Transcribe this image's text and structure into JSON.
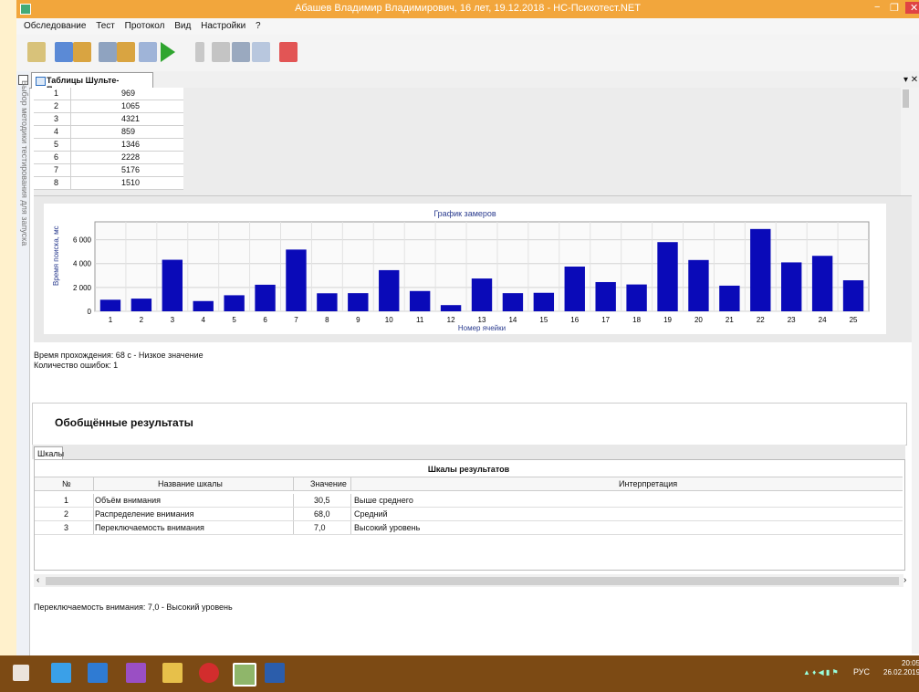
{
  "window": {
    "title": "Абашев Владимир Владимирович, 16 лет, 19.12.2018 - НС-Психотест.NET",
    "controls": [
      "−",
      "❐",
      "✕"
    ]
  },
  "menu": [
    "Обследование",
    "Тест",
    "Протокол",
    "Вид",
    "Настройки",
    "?"
  ],
  "side_panel_label": "Выбор методики тестирования для запуска",
  "doc_tab": "Таблицы Шульте-Платоно...",
  "measurements_table": [
    {
      "n": "1",
      "v": "969"
    },
    {
      "n": "2",
      "v": "1065"
    },
    {
      "n": "3",
      "v": "4321"
    },
    {
      "n": "4",
      "v": "859"
    },
    {
      "n": "5",
      "v": "1346"
    },
    {
      "n": "6",
      "v": "2228"
    },
    {
      "n": "7",
      "v": "5176"
    },
    {
      "n": "8",
      "v": "1510"
    }
  ],
  "chart_data": {
    "type": "bar",
    "title": "График замеров",
    "xlabel": "Номер ячейки",
    "ylabel": "Время поиска, мс",
    "categories": [
      "1",
      "2",
      "3",
      "4",
      "5",
      "6",
      "7",
      "8",
      "9",
      "10",
      "11",
      "12",
      "13",
      "14",
      "15",
      "16",
      "17",
      "18",
      "19",
      "20",
      "21",
      "22",
      "23",
      "24",
      "25"
    ],
    "values": [
      969,
      1065,
      4321,
      859,
      1346,
      2228,
      5176,
      1510,
      1520,
      3450,
      1700,
      520,
      2750,
      1520,
      1550,
      3750,
      2450,
      2250,
      5800,
      4300,
      2150,
      6900,
      4100,
      4650,
      2600
    ],
    "yticks": [
      "0",
      "2 000",
      "4 000",
      "6 000"
    ],
    "ylim": [
      0,
      7500
    ],
    "grid": true,
    "bar_color": "#0a0ab8"
  },
  "info": {
    "time": "Время прохождения: 68 с - Низкое значение",
    "errors": "Количество ошибок: 1"
  },
  "results": {
    "title": "Обобщённые результаты",
    "tab": "Шкалы",
    "grid_title": "Шкалы результатов",
    "columns": [
      "№",
      "Название шкалы",
      "Значение",
      "Интерпретация"
    ],
    "rows": [
      {
        "n": "1",
        "name": "Объём внимания",
        "value": "30,5",
        "interp": "Выше среднего"
      },
      {
        "n": "2",
        "name": "Распределение внимания",
        "value": "68,0",
        "interp": "Средний"
      },
      {
        "n": "3",
        "name": "Переключаемость внимания",
        "value": "7,0",
        "interp": "Высокий уровень"
      }
    ],
    "footer": "Переключаемость внимания: 7,0 - Высокий уровень"
  },
  "taskbar": {
    "lang": "РУС",
    "time": "20:05",
    "date": "26.02.2019"
  }
}
